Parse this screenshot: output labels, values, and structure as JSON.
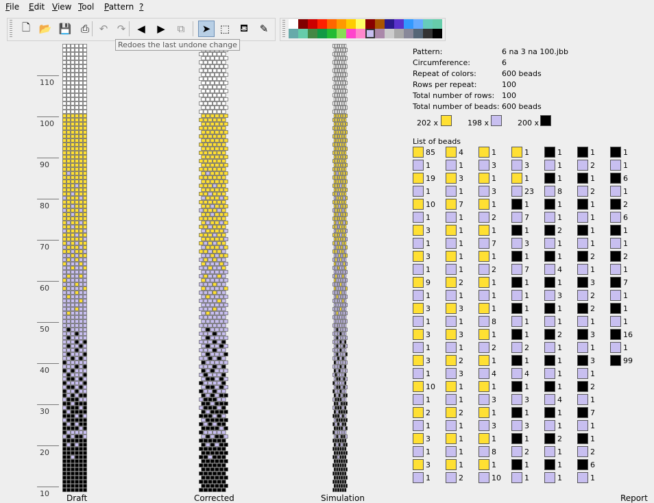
{
  "colors": {
    "yellow": "#ffe033",
    "lavender": "#c8bff0",
    "black": "#000000",
    "white": "#ffffff",
    "grid": "#444444",
    "bg": "#eeeeee"
  },
  "menu": [
    {
      "label": "File",
      "mnemonic": "F",
      "rest": "ile"
    },
    {
      "label": "Edit",
      "mnemonic": "E",
      "rest": "dit"
    },
    {
      "label": "View",
      "mnemonic": "V",
      "rest": "iew"
    },
    {
      "label": "Tool",
      "mnemonic": "T",
      "rest": "ool"
    },
    {
      "label": "Pattern",
      "mnemonic": "P",
      "rest": "attern"
    },
    {
      "label": "?",
      "mnemonic": "?",
      "rest": ""
    }
  ],
  "toolbar": {
    "buttons": [
      {
        "name": "new-file-icon",
        "glyph": "🗋",
        "state": "normal"
      },
      {
        "name": "open-file-icon",
        "glyph": "📂",
        "state": "normal"
      },
      {
        "name": "save-icon",
        "glyph": "💾",
        "state": "normal"
      },
      {
        "name": "print-icon",
        "glyph": "⎙",
        "state": "normal"
      },
      {
        "name": "undo-icon",
        "glyph": "↶",
        "state": "disabled"
      },
      {
        "name": "redo-icon",
        "glyph": "↷",
        "state": "disabled"
      },
      {
        "name": "arrow-left-icon",
        "glyph": "◀",
        "state": "normal"
      },
      {
        "name": "arrow-right-icon",
        "glyph": "▶",
        "state": "normal"
      },
      {
        "name": "copy-icon",
        "glyph": "⧉",
        "state": "disabled"
      },
      {
        "name": "select-pointer-icon",
        "glyph": "➤",
        "state": "active"
      },
      {
        "name": "rectangle-select-icon",
        "glyph": "⬚",
        "state": "normal"
      },
      {
        "name": "fill-bucket-icon",
        "glyph": "⛾",
        "state": "normal"
      },
      {
        "name": "eyedropper-icon",
        "glyph": "✎",
        "state": "normal"
      }
    ],
    "tooltip": "Redoes the last undone change"
  },
  "palette": [
    "#ffffff",
    "#800000",
    "#cc0000",
    "#ff2000",
    "#ff6600",
    "#ff9900",
    "#ffcc00",
    "#ffff66",
    "#880000",
    "#aa5500",
    "#2a1a8a",
    "#5a33cc",
    "#3399ff",
    "#66aaff",
    "#66ccbb",
    "#66ccaa",
    "#66aaaa",
    "#66ccaa",
    "#448844",
    "#119944",
    "#22bb33",
    "#88dd55",
    "#ff44cc",
    "#ff88cc",
    "#c8bff0",
    "#aa88aa",
    "#cccccc",
    "#aaaaaa",
    "#888899",
    "#556677",
    "#333333",
    "#000000"
  ],
  "palette_selected_index": 24,
  "ruler": {
    "labels": [
      "110",
      "100",
      "90",
      "80",
      "70",
      "60",
      "50",
      "40",
      "30",
      "20",
      "10"
    ]
  },
  "column_labels": {
    "draft": "Draft",
    "corrected": "Corrected",
    "simulation": "Simulation",
    "report": "Report"
  },
  "report": {
    "info": [
      {
        "label": "Pattern:",
        "value": "6 na 3 na 100.jbb"
      },
      {
        "label": "Circumference:",
        "value": "6"
      },
      {
        "label": "Repeat of colors:",
        "value": "600 beads"
      },
      {
        "label": "Rows per repeat:",
        "value": "100"
      },
      {
        "label": "Total number of rows:",
        "value": "100"
      },
      {
        "label": "Total number of beads:",
        "value": "600 beads"
      }
    ],
    "summary": [
      {
        "count": "202 x",
        "color": "yellow"
      },
      {
        "count": "198 x",
        "color": "lavender"
      },
      {
        "count": "200 x",
        "color": "black"
      }
    ],
    "list_title": "List of beads",
    "bead_columns": [
      [
        [
          "Y",
          "85"
        ],
        [
          "L",
          "1"
        ],
        [
          "Y",
          "19"
        ],
        [
          "L",
          "1"
        ],
        [
          "Y",
          "10"
        ],
        [
          "L",
          "1"
        ],
        [
          "Y",
          "3"
        ],
        [
          "L",
          "1"
        ],
        [
          "Y",
          "3"
        ],
        [
          "L",
          "1"
        ],
        [
          "Y",
          "9"
        ],
        [
          "L",
          "1"
        ],
        [
          "Y",
          "3"
        ],
        [
          "L",
          "1"
        ],
        [
          "Y",
          "3"
        ],
        [
          "L",
          "1"
        ],
        [
          "Y",
          "3"
        ],
        [
          "L",
          "1"
        ],
        [
          "Y",
          "10"
        ],
        [
          "L",
          "1"
        ],
        [
          "Y",
          "2"
        ],
        [
          "L",
          "1"
        ],
        [
          "Y",
          "3"
        ],
        [
          "L",
          "1"
        ],
        [
          "Y",
          "3"
        ],
        [
          "L",
          "1"
        ]
      ],
      [
        [
          "Y",
          "4"
        ],
        [
          "L",
          "1"
        ],
        [
          "Y",
          "3"
        ],
        [
          "L",
          "1"
        ],
        [
          "Y",
          "7"
        ],
        [
          "L",
          "1"
        ],
        [
          "Y",
          "1"
        ],
        [
          "L",
          "1"
        ],
        [
          "Y",
          "1"
        ],
        [
          "L",
          "1"
        ],
        [
          "Y",
          "2"
        ],
        [
          "L",
          "1"
        ],
        [
          "Y",
          "3"
        ],
        [
          "L",
          "1"
        ],
        [
          "Y",
          "3"
        ],
        [
          "L",
          "1"
        ],
        [
          "Y",
          "2"
        ],
        [
          "L",
          "3"
        ],
        [
          "Y",
          "1"
        ],
        [
          "L",
          "1"
        ],
        [
          "Y",
          "2"
        ],
        [
          "L",
          "1"
        ],
        [
          "Y",
          "1"
        ],
        [
          "L",
          "1"
        ],
        [
          "Y",
          "1"
        ],
        [
          "L",
          "2"
        ]
      ],
      [
        [
          "Y",
          "1"
        ],
        [
          "L",
          "3"
        ],
        [
          "Y",
          "1"
        ],
        [
          "L",
          "3"
        ],
        [
          "Y",
          "1"
        ],
        [
          "L",
          "2"
        ],
        [
          "Y",
          "1"
        ],
        [
          "L",
          "7"
        ],
        [
          "Y",
          "1"
        ],
        [
          "L",
          "2"
        ],
        [
          "Y",
          "1"
        ],
        [
          "L",
          "1"
        ],
        [
          "Y",
          "1"
        ],
        [
          "L",
          "8"
        ],
        [
          "Y",
          "1"
        ],
        [
          "L",
          "2"
        ],
        [
          "Y",
          "1"
        ],
        [
          "L",
          "4"
        ],
        [
          "Y",
          "1"
        ],
        [
          "L",
          "3"
        ],
        [
          "Y",
          "1"
        ],
        [
          "L",
          "3"
        ],
        [
          "Y",
          "1"
        ],
        [
          "L",
          "8"
        ],
        [
          "Y",
          "1"
        ],
        [
          "L",
          "10"
        ]
      ],
      [
        [
          "Y",
          "1"
        ],
        [
          "L",
          "3"
        ],
        [
          "Y",
          "1"
        ],
        [
          "L",
          "23"
        ],
        [
          "B",
          "1"
        ],
        [
          "L",
          "7"
        ],
        [
          "B",
          "1"
        ],
        [
          "L",
          "3"
        ],
        [
          "B",
          "1"
        ],
        [
          "L",
          "7"
        ],
        [
          "B",
          "1"
        ],
        [
          "L",
          "1"
        ],
        [
          "B",
          "1"
        ],
        [
          "L",
          "1"
        ],
        [
          "B",
          "1"
        ],
        [
          "L",
          "2"
        ],
        [
          "B",
          "1"
        ],
        [
          "L",
          "4"
        ],
        [
          "B",
          "1"
        ],
        [
          "L",
          "3"
        ],
        [
          "B",
          "1"
        ],
        [
          "L",
          "3"
        ],
        [
          "B",
          "1"
        ],
        [
          "L",
          "2"
        ],
        [
          "B",
          "1"
        ],
        [
          "L",
          "1"
        ]
      ],
      [
        [
          "B",
          "1"
        ],
        [
          "L",
          "1"
        ],
        [
          "B",
          "1"
        ],
        [
          "L",
          "8"
        ],
        [
          "B",
          "1"
        ],
        [
          "L",
          "1"
        ],
        [
          "B",
          "2"
        ],
        [
          "L",
          "1"
        ],
        [
          "B",
          "1"
        ],
        [
          "L",
          "4"
        ],
        [
          "B",
          "1"
        ],
        [
          "L",
          "3"
        ],
        [
          "B",
          "1"
        ],
        [
          "L",
          "1"
        ],
        [
          "B",
          "2"
        ],
        [
          "L",
          "1"
        ],
        [
          "B",
          "1"
        ],
        [
          "L",
          "1"
        ],
        [
          "B",
          "1"
        ],
        [
          "L",
          "4"
        ],
        [
          "B",
          "1"
        ],
        [
          "L",
          "1"
        ],
        [
          "B",
          "2"
        ],
        [
          "L",
          "1"
        ],
        [
          "B",
          "1"
        ],
        [
          "L",
          "1"
        ]
      ],
      [
        [
          "B",
          "1"
        ],
        [
          "L",
          "2"
        ],
        [
          "B",
          "1"
        ],
        [
          "L",
          "2"
        ],
        [
          "B",
          "1"
        ],
        [
          "L",
          "1"
        ],
        [
          "B",
          "1"
        ],
        [
          "L",
          "1"
        ],
        [
          "B",
          "2"
        ],
        [
          "L",
          "1"
        ],
        [
          "B",
          "3"
        ],
        [
          "L",
          "2"
        ],
        [
          "B",
          "2"
        ],
        [
          "L",
          "1"
        ],
        [
          "B",
          "3"
        ],
        [
          "L",
          "1"
        ],
        [
          "B",
          "3"
        ],
        [
          "L",
          "1"
        ],
        [
          "B",
          "2"
        ],
        [
          "L",
          "1"
        ],
        [
          "B",
          "7"
        ],
        [
          "L",
          "1"
        ],
        [
          "B",
          "1"
        ],
        [
          "L",
          "2"
        ],
        [
          "B",
          "6"
        ],
        [
          "L",
          "1"
        ]
      ],
      [
        [
          "B",
          "1"
        ],
        [
          "L",
          "1"
        ],
        [
          "B",
          "6"
        ],
        [
          "L",
          "1"
        ],
        [
          "B",
          "2"
        ],
        [
          "L",
          "6"
        ],
        [
          "B",
          "1"
        ],
        [
          "L",
          "1"
        ],
        [
          "B",
          "2"
        ],
        [
          "L",
          "1"
        ],
        [
          "B",
          "7"
        ],
        [
          "L",
          "1"
        ],
        [
          "B",
          "1"
        ],
        [
          "L",
          "1"
        ],
        [
          "B",
          "16"
        ],
        [
          "L",
          "1"
        ],
        [
          "B",
          "99"
        ]
      ]
    ]
  }
}
